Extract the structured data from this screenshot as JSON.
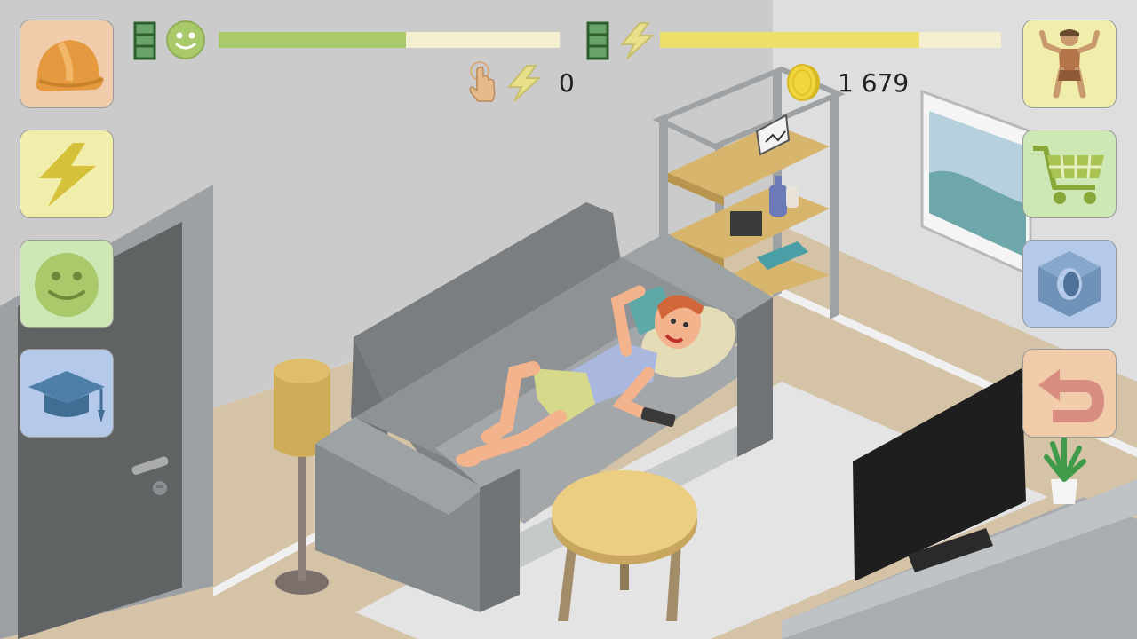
{
  "hud": {
    "energy_bar": {
      "fill": 0.55,
      "track_color": "#f4f0cf",
      "fill_color": "#a9c96a"
    },
    "power_bar": {
      "fill": 0.76,
      "track_color": "#f4f0cf",
      "fill_color": "#ede06a"
    },
    "taps_energy_value": "0",
    "coins_value": "1 679"
  },
  "left_menu": [
    {
      "name": "work-button",
      "icon": "hard-hat-icon",
      "bg": "#f1ccab"
    },
    {
      "name": "energy-button",
      "icon": "lightning-icon",
      "bg": "#f1eeac"
    },
    {
      "name": "mood-button",
      "icon": "smiley-icon",
      "bg": "#cde8b4"
    },
    {
      "name": "education-button",
      "icon": "graduation-cap-icon",
      "bg": "#b5c9ea"
    }
  ],
  "right_menu": [
    {
      "name": "character-button",
      "icon": "character-icon",
      "bg": "#f1eeac"
    },
    {
      "name": "shop-button",
      "icon": "shopping-cart-icon",
      "bg": "#cde8b4"
    },
    {
      "name": "settings-button",
      "icon": "hex-nut-icon",
      "bg": "#b5c9ea"
    },
    {
      "name": "back-button",
      "icon": "back-arrow-icon",
      "bg": "#f1ccab"
    }
  ]
}
